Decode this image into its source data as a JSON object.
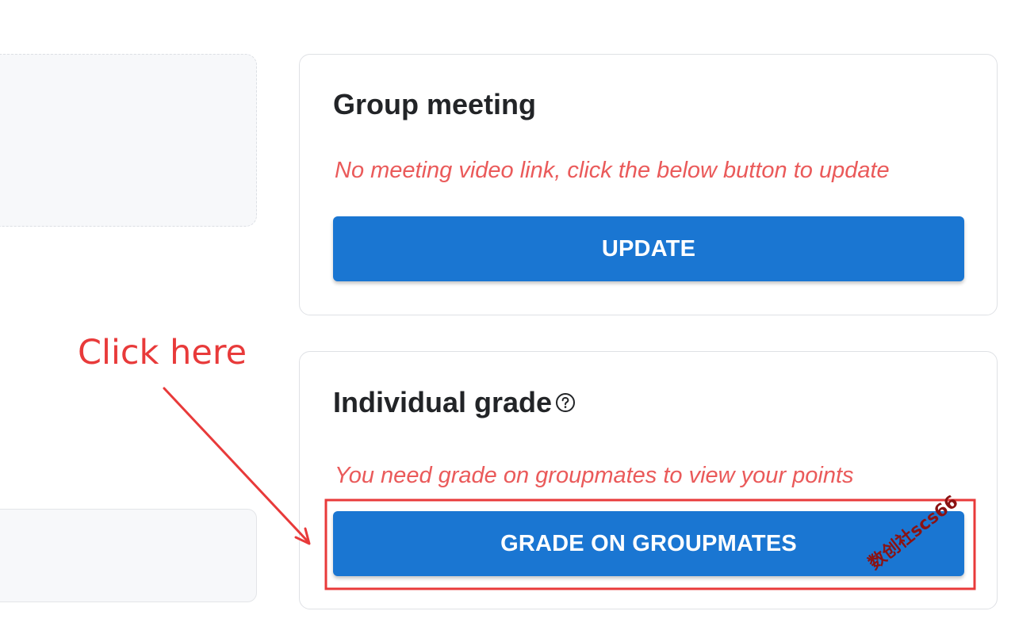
{
  "meeting_card": {
    "title": "Group meeting",
    "notice": "No meeting video link, click the below button to update",
    "button_label": "UPDATE"
  },
  "grade_card": {
    "title": "Individual grade",
    "help_icon": "question-circle-icon",
    "notice": "You need grade on groupmates to view your points",
    "button_label": "GRADE ON GROUPMATES"
  },
  "annotation": {
    "text": "Click here",
    "color": "#e83a3a"
  },
  "watermark": {
    "text": "数创社scs66"
  },
  "colors": {
    "primary_button": "#1a76d2",
    "notice_text": "#ea5a5a",
    "title_text": "#222427"
  }
}
